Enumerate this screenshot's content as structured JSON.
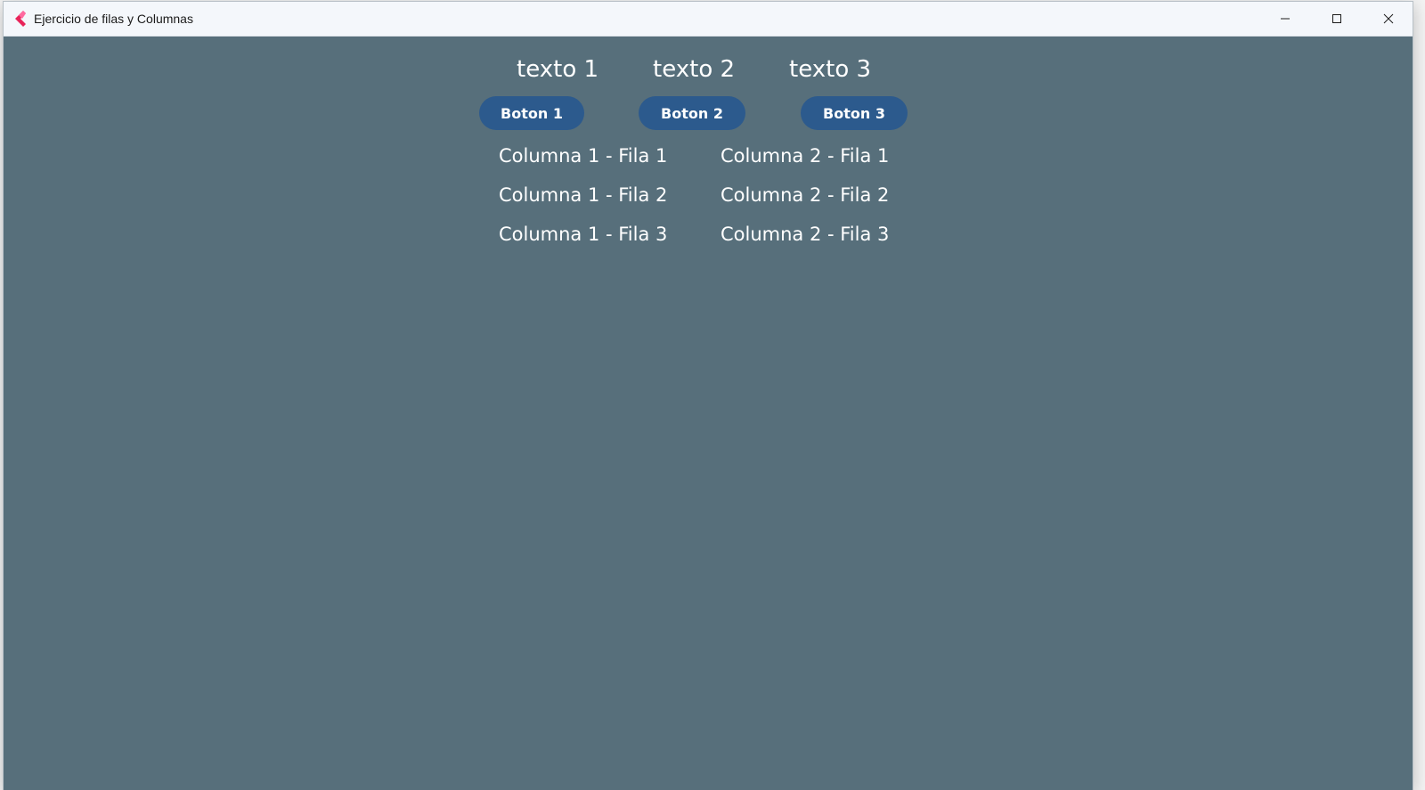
{
  "window": {
    "title": "Ejercicio de filas y Columnas",
    "icon": "flutter-icon",
    "controls": {
      "minimize": "minimize-icon",
      "maximize": "maximize-icon",
      "close": "close-icon"
    }
  },
  "main": {
    "texts": [
      "texto 1",
      "texto 2",
      "texto 3"
    ],
    "buttons": [
      "Boton 1",
      "Boton 2",
      "Boton 3"
    ],
    "grid": {
      "column1": [
        "Columna 1 - Fila 1",
        "Columna 1 - Fila 2",
        "Columna 1 - Fila 3"
      ],
      "column2": [
        "Columna 2 - Fila 1",
        "Columna 2 - Fila 2",
        "Columna 2 - Fila 3"
      ]
    }
  },
  "colors": {
    "background": "#576f7b",
    "button": "#2c5a8d",
    "text": "#ffffff",
    "titlebar": "#f4f7fb"
  }
}
